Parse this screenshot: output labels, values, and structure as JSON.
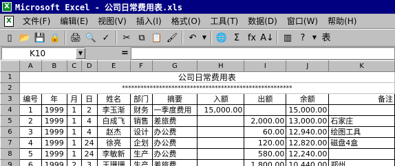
{
  "window": {
    "title": "Microsoft Excel - 公司日常费用表.xls"
  },
  "menu": [
    "文件(F)",
    "编辑(E)",
    "视图(V)",
    "插入(I)",
    "格式(O)",
    "工具(T)",
    "数据(D)",
    "窗口(W)",
    "帮助(H)"
  ],
  "toolbar": {
    "icons": [
      "new-icon",
      "open-icon",
      "save-icon",
      "permission-icon",
      "print-icon",
      "print-preview-icon",
      "spelling-icon",
      "cut-icon",
      "copy-icon",
      "paste-icon",
      "format-painter-icon",
      "undo-icon",
      "hyperlink-icon",
      "autosum-icon",
      "function-icon",
      "sort-ascending-icon",
      "chart-wizard-icon",
      "help-icon"
    ],
    "glyphs": [
      "▯",
      "📂",
      "💾",
      "🔒",
      "🖨",
      "🔍",
      "✓",
      "✂",
      "⧉",
      "📋",
      "🖌",
      "↶",
      "🌐",
      "Σ",
      "fx",
      "A↓",
      "▥",
      "?"
    ],
    "table_label": "表"
  },
  "formula_bar": {
    "cell_ref": "K10",
    "eq": "=",
    "formula": ""
  },
  "columns": [
    "A",
    "B",
    "C",
    "D",
    "E",
    "F",
    "G",
    "H",
    "I",
    "J",
    "K"
  ],
  "rows": [
    "1",
    "2",
    "3",
    "4",
    "5",
    "6",
    "7",
    "8",
    "9"
  ],
  "sheet": {
    "title": "公司日常费用表",
    "stars": "*******************************************************",
    "headers": [
      "编号",
      "年",
      "月",
      "日",
      "姓名",
      "部门",
      "摘要",
      "入额",
      "出额",
      "余额",
      "备注"
    ],
    "records": [
      [
        "1",
        "1999",
        "1",
        "2",
        "李玉渐",
        "财务",
        "一季度费用",
        "15,000.00",
        "",
        "15,000.00",
        ""
      ],
      [
        "2",
        "1999",
        "1",
        "4",
        "白成飞",
        "销售",
        "差旅费",
        "",
        "2,000.00",
        "13,000.00",
        "石家庄"
      ],
      [
        "3",
        "1999",
        "1",
        "4",
        "赵杰",
        "设计",
        "办公费",
        "",
        "60.00",
        "12,940.00",
        "绘图工具"
      ],
      [
        "4",
        "1999",
        "1",
        "24",
        "徐亮",
        "企划",
        "办公费",
        "",
        "120.00",
        "12,820.00",
        "磁盘4盒"
      ],
      [
        "5",
        "1999",
        "1",
        "24",
        "李敏新",
        "生产",
        "办公费",
        "",
        "580.00",
        "12,240.00",
        ""
      ],
      [
        "6",
        "1999",
        "2",
        "3",
        "王珊珊",
        "生产",
        "差旅费",
        "",
        "1,800.00",
        "10,440.00",
        "郑州"
      ]
    ]
  }
}
